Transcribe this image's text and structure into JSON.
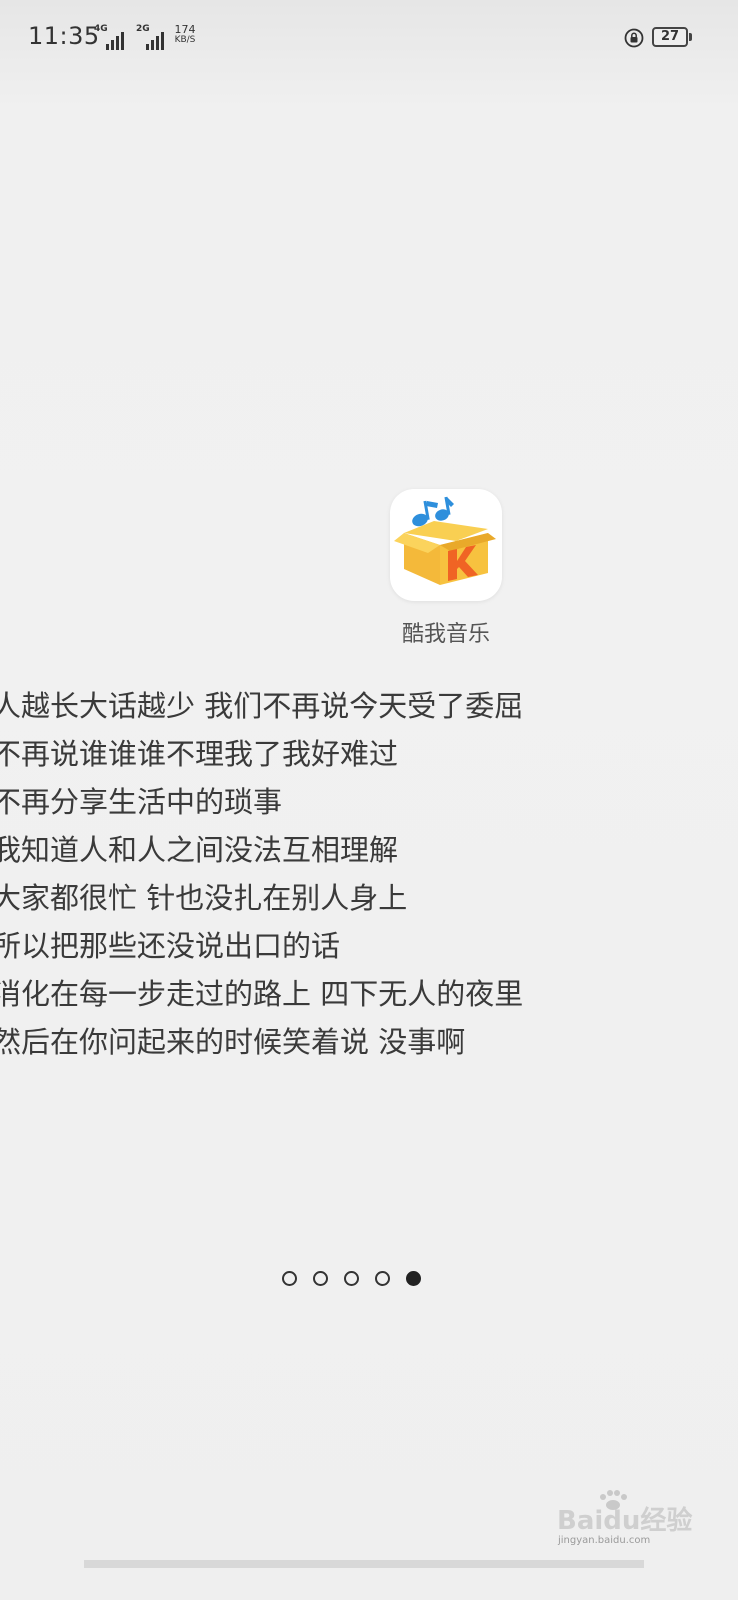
{
  "status_bar": {
    "time": "11:35",
    "network_1": "4G",
    "network_2": "2G",
    "speed_value": "174",
    "speed_unit": "KB/S",
    "battery_level": "27",
    "battery_icon": "battery-icon",
    "lock_icon": "rotation-lock-icon"
  },
  "app": {
    "name": "酷我音乐",
    "icon": "kuwo-music-app-icon",
    "brand_colors": {
      "box": "#f7c23f",
      "box_shadow": "#e9a92a",
      "letter": "#f06424",
      "notes": "#2e8fdc"
    }
  },
  "lyrics": [
    "人越长大话越少 我们不再说今天受了委屈",
    "不再说谁谁谁不理我了我好难过",
    "不再分享生活中的琐事",
    "我知道人和人之间没法互相理解",
    "大家都很忙 针也没扎在别人身上",
    "所以把那些还没说出口的话",
    "消化在每一步走过的路上 四下无人的夜里",
    "然后在你问起来的时候笑着说 没事啊"
  ],
  "pager": {
    "total_pages": 5,
    "current_page": 5
  },
  "watermark": {
    "brand": "Baidu经验",
    "url": "jingyan.baidu.com"
  }
}
